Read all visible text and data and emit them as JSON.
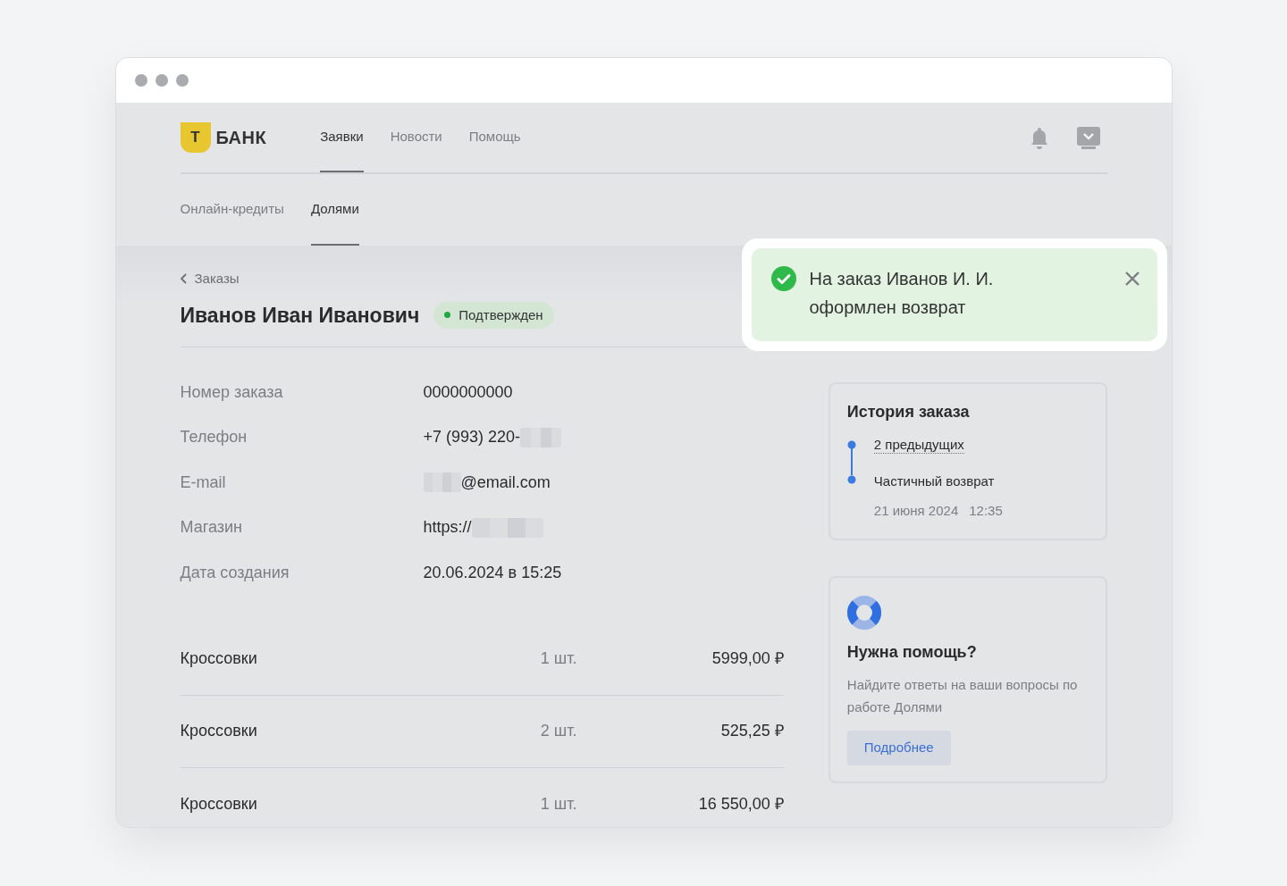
{
  "header": {
    "logo_letter": "Т",
    "logo_text": "БАНК",
    "nav": [
      {
        "label": "Заявки",
        "selected": true
      },
      {
        "label": "Новости",
        "selected": false
      },
      {
        "label": "Помощь",
        "selected": false
      }
    ]
  },
  "subnav": [
    {
      "label": "Онлайн-кредиты",
      "selected": false
    },
    {
      "label": "Долями",
      "selected": true
    }
  ],
  "back_link": "Заказы",
  "title": "Иванов Иван Иванович",
  "status": {
    "label": "Подтвержден",
    "color": "#22a843"
  },
  "details": [
    {
      "label": "Номер заказа",
      "value": "0000000000",
      "kind": "plain"
    },
    {
      "label": "Телефон",
      "value": "+7 (993) 220-",
      "kind": "masked_end"
    },
    {
      "label": "E-mail",
      "value": "@email.com",
      "kind": "masked_start"
    },
    {
      "label": "Магазин",
      "value": "https://",
      "kind": "masked_end"
    },
    {
      "label": "Дата создания",
      "value": "20.06.2024 в 15:25",
      "kind": "plain"
    }
  ],
  "items": [
    {
      "name": "Кроссовки",
      "qty": "1 шт.",
      "price": "5999,00 ₽"
    },
    {
      "name": "Кроссовки",
      "qty": "2 шт.",
      "price": "525,25 ₽"
    },
    {
      "name": "Кроссовки",
      "qty": "1 шт.",
      "price": "16 550,00 ₽"
    }
  ],
  "history": {
    "title": "История заказа",
    "previous_link": "2 предыдущих",
    "event": "Частичный возврат",
    "date": "21 июня 2024",
    "time": "12:35"
  },
  "help": {
    "title": "Нужна помощь?",
    "text": "Найдите ответы на ваши вопросы по работе Долями",
    "button": "Подробнее"
  },
  "toast": {
    "message_line1": "На заказ Иванов И. И.",
    "message_line2": "оформлен возврат"
  }
}
